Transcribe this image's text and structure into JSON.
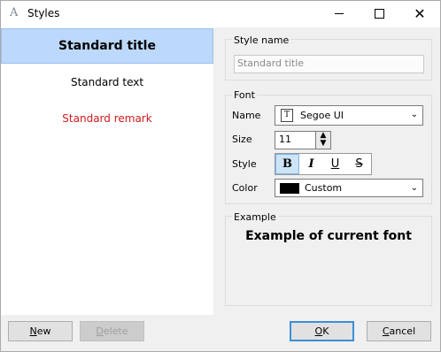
{
  "window": {
    "app_icon": "A",
    "title": "Styles",
    "minimize_icon": "minimize-icon",
    "maximize_icon": "maximize-icon",
    "close_icon": "close-icon"
  },
  "style_list": {
    "items": [
      {
        "label": "Standard title",
        "selected": true
      },
      {
        "label": "Standard text",
        "selected": false
      },
      {
        "label": "Standard remark",
        "selected": false,
        "color": "#d11a1a"
      }
    ]
  },
  "style_name": {
    "group_label": "Style name",
    "value": "Standard title"
  },
  "font": {
    "group_label": "Font",
    "name_label": "Name",
    "name_value": "Segoe UI",
    "size_label": "Size",
    "size_value": "11",
    "style_label": "Style",
    "style_buttons": [
      {
        "glyph": "B",
        "icon": "bold-icon",
        "active": true
      },
      {
        "glyph": "I",
        "icon": "italic-icon",
        "active": false
      },
      {
        "glyph": "U",
        "icon": "underline-icon",
        "active": false
      },
      {
        "glyph": "S",
        "icon": "strikethrough-icon",
        "active": false
      }
    ],
    "color_label": "Color",
    "color_value": "Custom",
    "color_swatch": "#000000"
  },
  "example": {
    "group_label": "Example",
    "text": "Example of current font"
  },
  "buttons": {
    "new_accel": "N",
    "new_rest": "ew",
    "delete_accel": "D",
    "delete_rest": "elete",
    "ok_accel": "O",
    "ok_rest": "K",
    "cancel_accel": "C",
    "cancel_rest": "ancel"
  },
  "colors": {
    "selection": "#bcd8fa",
    "remark": "#d11a1a",
    "accent": "#3c8fd8"
  }
}
